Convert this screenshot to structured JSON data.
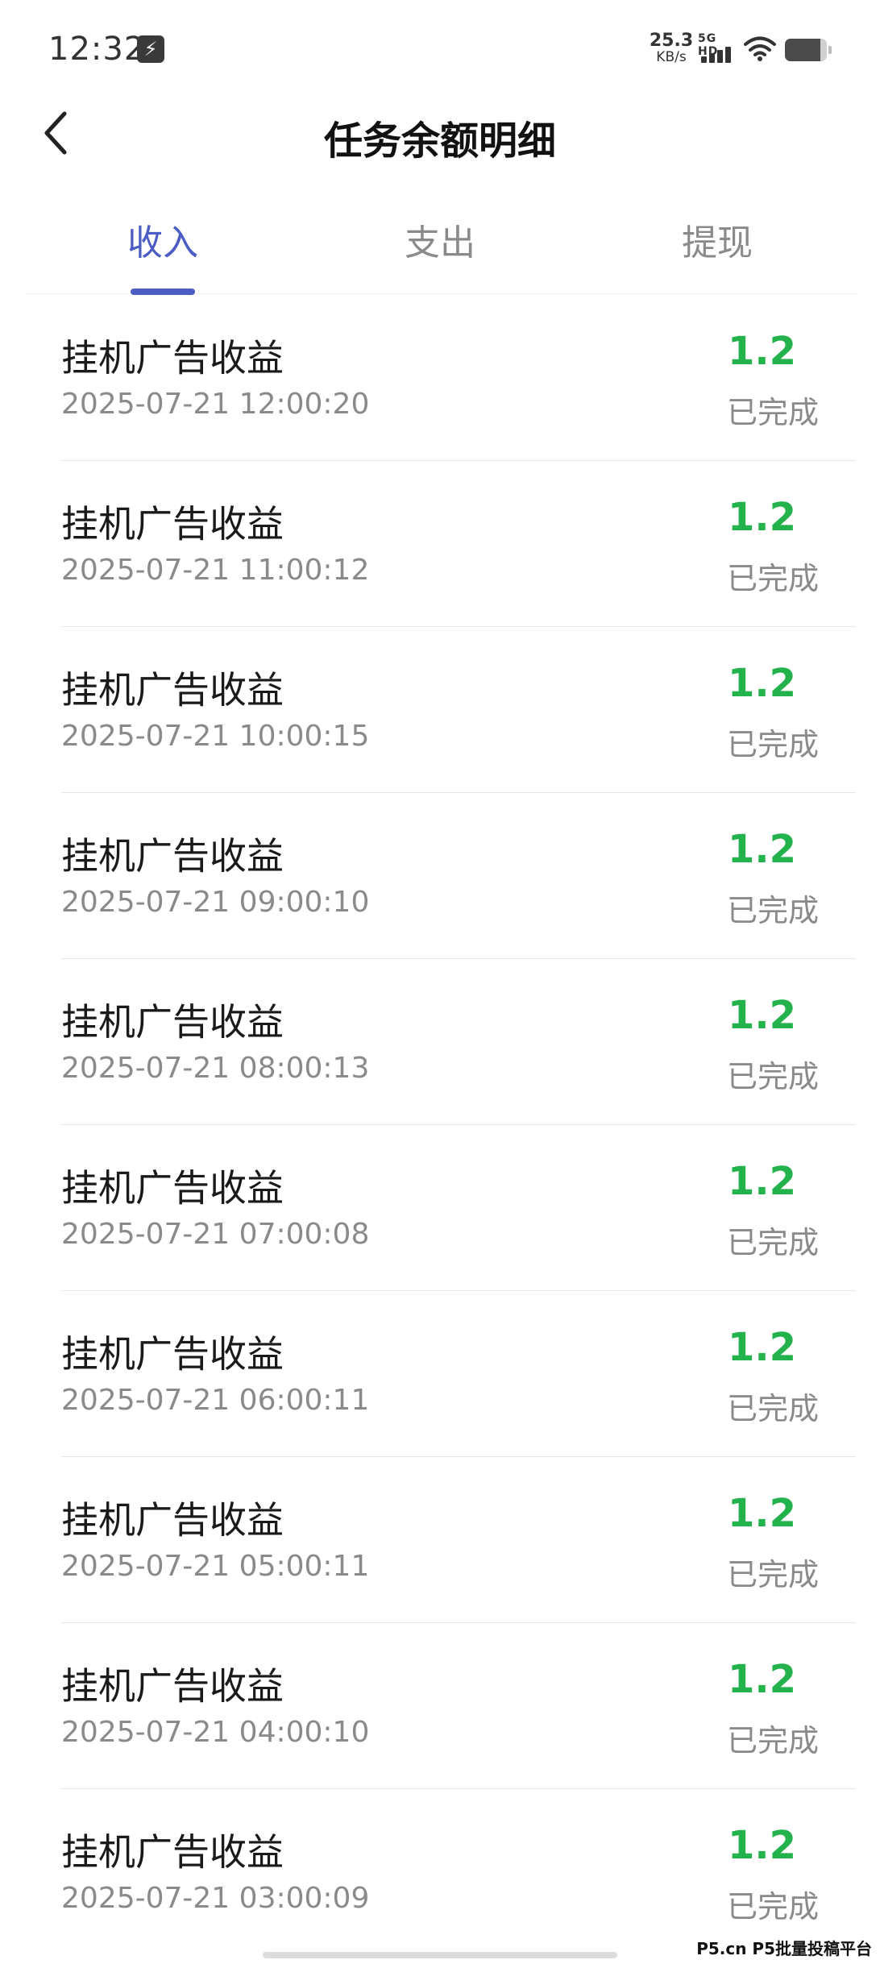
{
  "status_bar": {
    "time": "12:32",
    "net_speed_value": "25.3",
    "net_speed_unit": "KB/s",
    "network_type": "5G HD",
    "battery_level": 0.85
  },
  "header": {
    "title": "任务余额明细"
  },
  "tabs": [
    {
      "label": "收入",
      "active": true
    },
    {
      "label": "支出",
      "active": false
    },
    {
      "label": "提现",
      "active": false
    }
  ],
  "records": [
    {
      "name": "挂机广告收益",
      "time": "2025-07-21 12:00:20",
      "amount": "1.2",
      "status": "已完成"
    },
    {
      "name": "挂机广告收益",
      "time": "2025-07-21 11:00:12",
      "amount": "1.2",
      "status": "已完成"
    },
    {
      "name": "挂机广告收益",
      "time": "2025-07-21 10:00:15",
      "amount": "1.2",
      "status": "已完成"
    },
    {
      "name": "挂机广告收益",
      "time": "2025-07-21 09:00:10",
      "amount": "1.2",
      "status": "已完成"
    },
    {
      "name": "挂机广告收益",
      "time": "2025-07-21 08:00:13",
      "amount": "1.2",
      "status": "已完成"
    },
    {
      "name": "挂机广告收益",
      "time": "2025-07-21 07:00:08",
      "amount": "1.2",
      "status": "已完成"
    },
    {
      "name": "挂机广告收益",
      "time": "2025-07-21 06:00:11",
      "amount": "1.2",
      "status": "已完成"
    },
    {
      "name": "挂机广告收益",
      "time": "2025-07-21 05:00:11",
      "amount": "1.2",
      "status": "已完成"
    },
    {
      "name": "挂机广告收益",
      "time": "2025-07-21 04:00:10",
      "amount": "1.2",
      "status": "已完成"
    },
    {
      "name": "挂机广告收益",
      "time": "2025-07-21 03:00:09",
      "amount": "1.2",
      "status": "已完成"
    }
  ],
  "watermark": "P5.cn P5批量投稿平台",
  "colors": {
    "accent": "#4b5cc4",
    "amount": "#23b24b",
    "secondary_text": "#8a8a8a"
  },
  "icons": {
    "back": "chevron-left-icon",
    "flash": "flash-icon",
    "wifi": "wifi-icon",
    "battery": "battery-icon"
  }
}
